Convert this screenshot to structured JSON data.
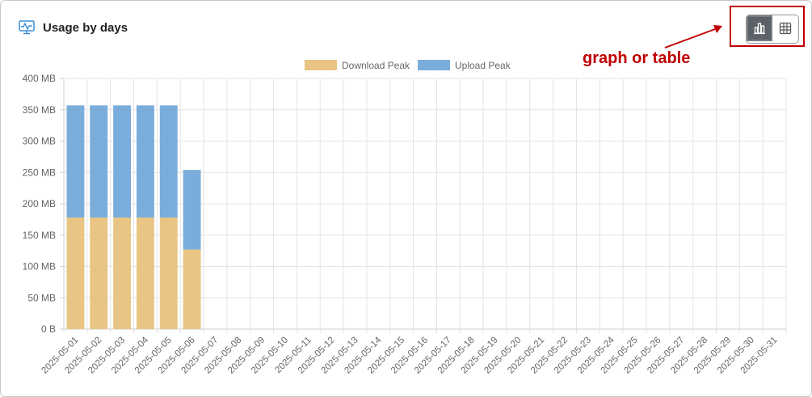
{
  "header": {
    "title": "Usage by days",
    "icon": "monitor-activity-icon"
  },
  "view_toggle": {
    "options": [
      {
        "name": "bar-chart-icon",
        "active": true
      },
      {
        "name": "table-grid-icon",
        "active": false
      }
    ]
  },
  "annotation": {
    "text": "graph or table",
    "color": "#c00000"
  },
  "chart_data": {
    "type": "bar",
    "stacked": true,
    "legend_position": "top-center",
    "grid": true,
    "ylim": [
      0,
      400
    ],
    "y_ticks": [
      "0 B",
      "50 MB",
      "100 MB",
      "150 MB",
      "200 MB",
      "250 MB",
      "300 MB",
      "350 MB",
      "400 MB"
    ],
    "y_tick_values": [
      0,
      50,
      100,
      150,
      200,
      250,
      300,
      350,
      400
    ],
    "categories": [
      "2025-05-01",
      "2025-05-02",
      "2025-05-03",
      "2025-05-04",
      "2025-05-05",
      "2025-05-06",
      "2025-05-07",
      "2025-05-08",
      "2025-05-09",
      "2025-05-10",
      "2025-05-11",
      "2025-05-12",
      "2025-05-13",
      "2025-05-14",
      "2025-05-15",
      "2025-05-16",
      "2025-05-17",
      "2025-05-18",
      "2025-05-19",
      "2025-05-20",
      "2025-05-21",
      "2025-05-22",
      "2025-05-23",
      "2025-05-24",
      "2025-05-25",
      "2025-05-26",
      "2025-05-27",
      "2025-05-28",
      "2025-05-29",
      "2025-05-30",
      "2025-05-31"
    ],
    "series": [
      {
        "name": "Download Peak",
        "color": "#e8c584",
        "values": [
          178,
          178,
          178,
          178,
          178,
          127,
          0,
          0,
          0,
          0,
          0,
          0,
          0,
          0,
          0,
          0,
          0,
          0,
          0,
          0,
          0,
          0,
          0,
          0,
          0,
          0,
          0,
          0,
          0,
          0,
          0
        ]
      },
      {
        "name": "Upload Peak",
        "color": "#7aaddb",
        "values": [
          179,
          179,
          179,
          179,
          179,
          127,
          0,
          0,
          0,
          0,
          0,
          0,
          0,
          0,
          0,
          0,
          0,
          0,
          0,
          0,
          0,
          0,
          0,
          0,
          0,
          0,
          0,
          0,
          0,
          0,
          0
        ]
      }
    ]
  }
}
